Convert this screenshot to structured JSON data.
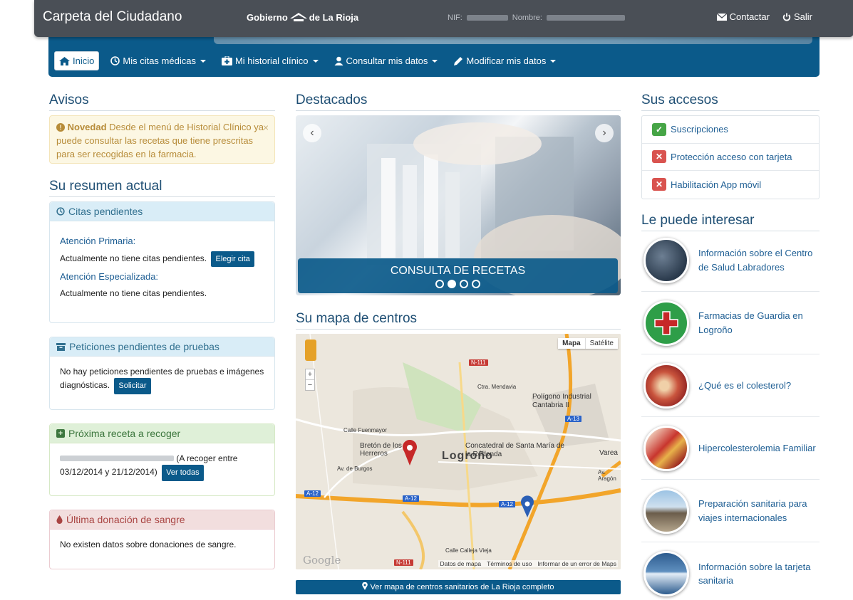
{
  "header": {
    "app_title": "Carpeta del Ciudadano",
    "gov_left": "Gobierno",
    "gov_right": "de La Rioja",
    "nif_label": "NIF:",
    "name_label": "Nombre:",
    "contact": "Contactar",
    "logout": "Salir"
  },
  "nav": {
    "home": "Inicio",
    "appointments": "Mis citas médicas",
    "history": "Mi historial clínico",
    "consult": "Consultar mis datos",
    "modify": "Modificar mis datos"
  },
  "avisos": {
    "title": "Avisos",
    "label": "Novedad",
    "text": "Desde el menú de Historial Clínico ya puede consultar las recetas que tiene prescritas para ser recogidas en la farmacia."
  },
  "summary": {
    "title": "Su resumen actual",
    "citas": {
      "header": "Citas pendientes",
      "primary_label": "Atención Primaria:",
      "primary_text": "Actualmente no tiene citas pendientes.",
      "primary_button": "Elegir cita",
      "special_label": "Atención Especializada:",
      "special_text": "Actualmente no tiene citas pendientes."
    },
    "pruebas": {
      "header": "Peticiones pendientes de pruebas",
      "text": "No hay peticiones pendientes de pruebas e imágenes diagnósticas.",
      "button": "Solicitar"
    },
    "receta": {
      "header": "Próxima receta a recoger",
      "text_suffix": "(A recoger entre 03/12/2014 y 21/12/2014)",
      "button": "Ver todas"
    },
    "donacion": {
      "header": "Última donación de sangre",
      "text": "No existen datos sobre donaciones de sangre."
    }
  },
  "destacados": {
    "title": "Destacados",
    "caption": "CONSULTA DE RECETAS",
    "active_slide": 2,
    "slide_count": 4
  },
  "map": {
    "title": "Su mapa de centros",
    "btn_map": "Mapa",
    "btn_sat": "Satélite",
    "labels": {
      "city": "Logroño",
      "poligono": "Polígono Industrial Cantabria II",
      "concatedral": "Concatedral de Santa María de la Redonda",
      "breton": "Bretón de los Herreros",
      "fuenmayor": "Calle Fuenmayor",
      "burgos": "Av. de Burgos",
      "varea": "Varea",
      "aragon": "Av. Aragón",
      "mendavia": "Ctra. Mendavia",
      "calleja": "Calle Calleja Vieja"
    },
    "roads": {
      "n111": "N-111",
      "a12": "A-12",
      "a13": "A-13"
    },
    "footer": {
      "data": "Datos de mapa",
      "terms": "Términos de uso",
      "report": "Informar de un error de Maps",
      "google": "Google"
    },
    "cta": "Ver mapa de centros sanitarios de La Rioja completo"
  },
  "accesos": {
    "title": "Sus accesos",
    "items": [
      {
        "label": "Suscripciones",
        "status": "ok"
      },
      {
        "label": "Protección acceso con tarjeta",
        "status": "no"
      },
      {
        "label": "Habilitación App móvil",
        "status": "no"
      }
    ]
  },
  "interesar": {
    "title": "Le puede interesar",
    "items": [
      {
        "label": "Información sobre el Centro de Salud Labradores"
      },
      {
        "label": "Farmacias de Guardia en Logroño"
      },
      {
        "label": "¿Qué es el colesterol?"
      },
      {
        "label": "Hipercolesterolemia Familiar"
      },
      {
        "label": "Preparación sanitaria para viajes internacionales"
      },
      {
        "label": "Información sobre la tarjeta sanitaria"
      }
    ]
  },
  "colors": {
    "brand_blue": "#0b5a8a",
    "topbar": "#4a4f56",
    "ok_green": "#46a546",
    "no_red": "#d9534f"
  }
}
